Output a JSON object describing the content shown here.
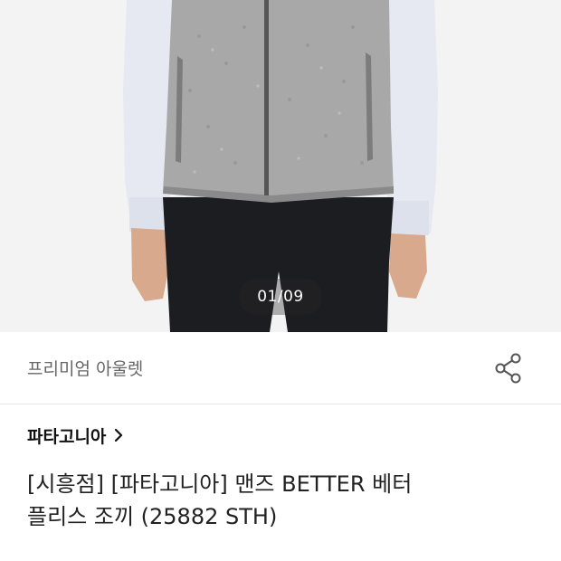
{
  "gallery": {
    "current": "01",
    "total": "09",
    "separator": "/"
  },
  "seller": {
    "name": "프리미엄 아울렛"
  },
  "icons": {
    "share": "share-icon",
    "chevron": "chevron-right-icon"
  },
  "product": {
    "brand": "파타고니아",
    "title_line1": "[시흥점] [파타고니아] 맨즈 BETTER 베터",
    "title_line2": "플리스 조끼 (25882 STH)"
  },
  "colors": {
    "background": "#ffffff",
    "image_background": "#f3f3f3",
    "vest": "#a8a8a8",
    "shirt": "#e6e9f2",
    "pants": "#1c1d20",
    "indicator_bg": "rgba(40,40,40,0.35)"
  }
}
